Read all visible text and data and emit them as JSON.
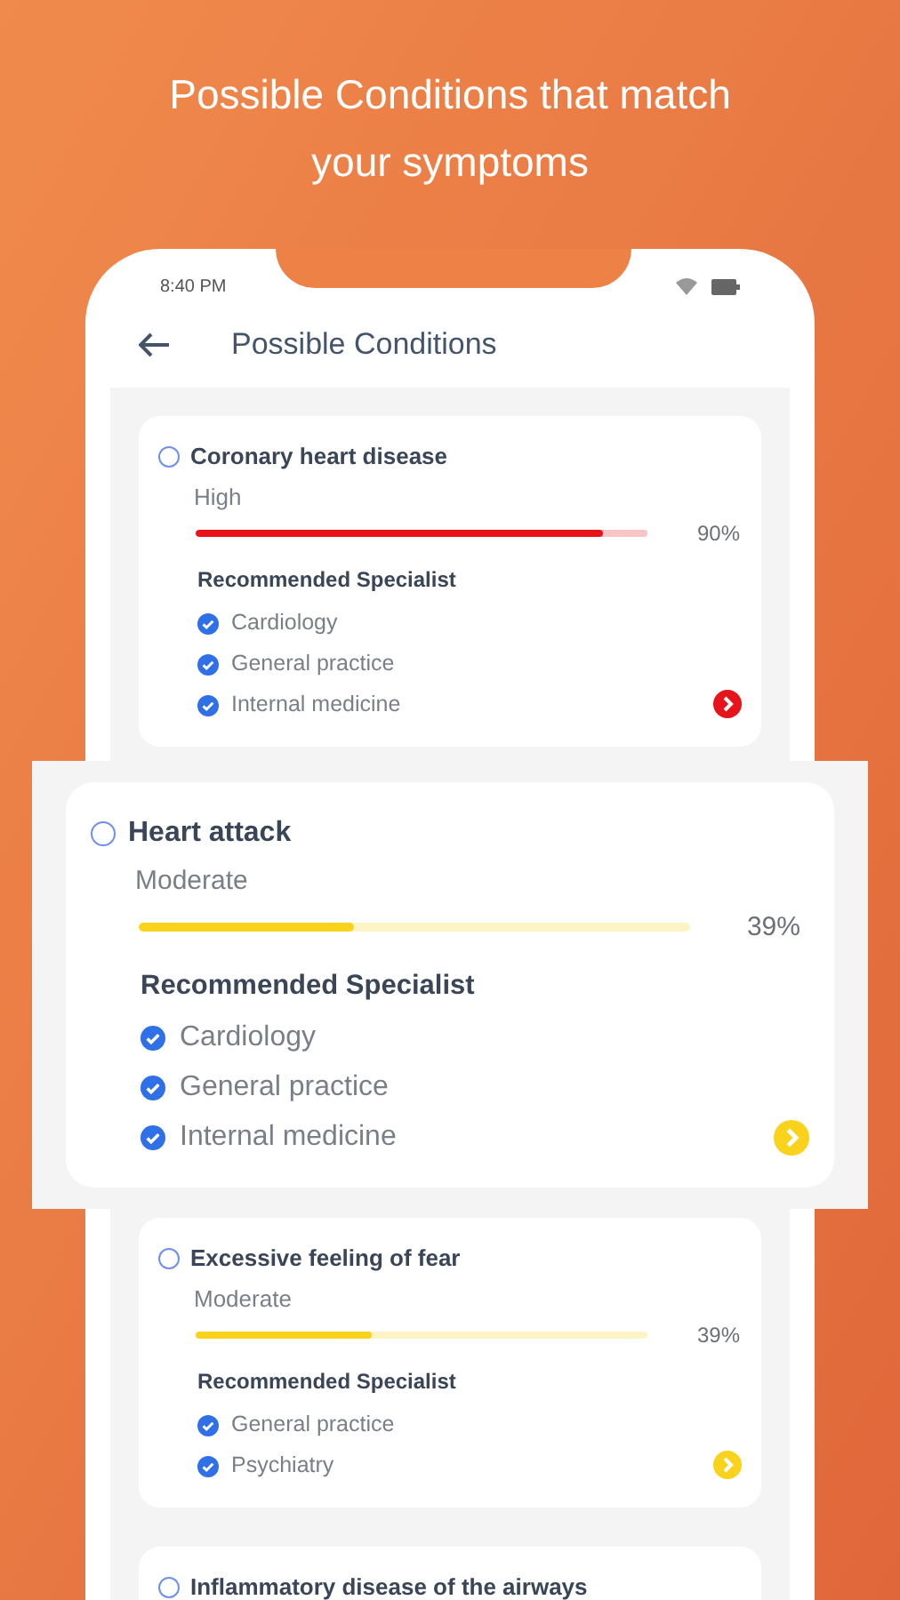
{
  "headline": "Possible Conditions that match your symptoms",
  "status_bar": {
    "time": "8:40 PM"
  },
  "header": {
    "title": "Possible Conditions"
  },
  "conditions": [
    {
      "kind": "card",
      "name": "Coronary heart disease",
      "checked": false,
      "severity": "High",
      "level": 0.9,
      "percent": "90%",
      "color": "#e8141b",
      "specialist_heading": "Recommended Specialist",
      "specialists": [
        {
          "label": "Cardiology",
          "checked": true
        },
        {
          "label": "General practice",
          "checked": true
        },
        {
          "label": "Internal medicine",
          "checked": true
        }
      ]
    },
    {
      "kind": "zoomed",
      "name": "Heart attack",
      "checked": false,
      "severity": "Moderate",
      "level": 0.39,
      "percent": "39%",
      "color": "#f9d21c",
      "specialist_heading": "Recommended Specialist",
      "specialists": [
        {
          "label": "Cardiology",
          "checked": true
        },
        {
          "label": "General practice",
          "checked": true
        },
        {
          "label": "Internal medicine",
          "checked": true
        }
      ]
    },
    {
      "kind": "card",
      "name": "Excessive feeling of fear",
      "checked": false,
      "severity": "Moderate",
      "level": 0.39,
      "percent": "39%",
      "color": "#f9d21c",
      "specialist_heading": "Recommended Specialist",
      "specialists": [
        {
          "label": "General practice",
          "checked": true
        },
        {
          "label": "Psychiatry",
          "checked": true
        }
      ]
    },
    {
      "kind": "card",
      "name": "Inflammatory disease of the airways",
      "checked": false
    }
  ]
}
